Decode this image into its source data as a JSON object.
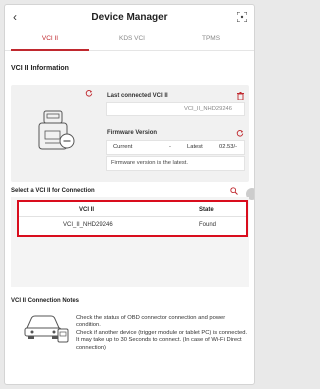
{
  "header": {
    "back_icon": "chevron-left-icon",
    "title": "Device Manager",
    "scan_icon": "scan-icon"
  },
  "tabs": [
    {
      "label": "VCI II",
      "active": true
    },
    {
      "label": "KDS VCI",
      "active": false
    },
    {
      "label": "TPMS",
      "active": false
    }
  ],
  "info": {
    "section_title": "VCI II Information",
    "last_connected_label": "Last connected VCI II",
    "last_connected_value": "VCI_II_NHD29246",
    "firmware_label": "Firmware Version",
    "current_label": "Current",
    "current_value": "-",
    "latest_label": "Latest",
    "latest_value": "02.53/-",
    "firmware_status": "Firmware version is the latest."
  },
  "selection": {
    "section_title": "Select a VCI II for Connection",
    "columns": [
      "VCI II",
      "State"
    ],
    "rows": [
      {
        "vci": "VCI_II_NHD29246",
        "state": "Found"
      }
    ]
  },
  "notes": {
    "section_title": "VCI II Connection Notes",
    "lines": [
      "Check the status of OBD connector connection and power condition.",
      "Check if another device (trigger module or tablet PC) is connected.",
      "It may take up to 30 Seconds to connect. (In case of Wi-Fi Direct connection)"
    ]
  },
  "colors": {
    "accent": "#c0282e",
    "highlight": "#d90d1d"
  }
}
